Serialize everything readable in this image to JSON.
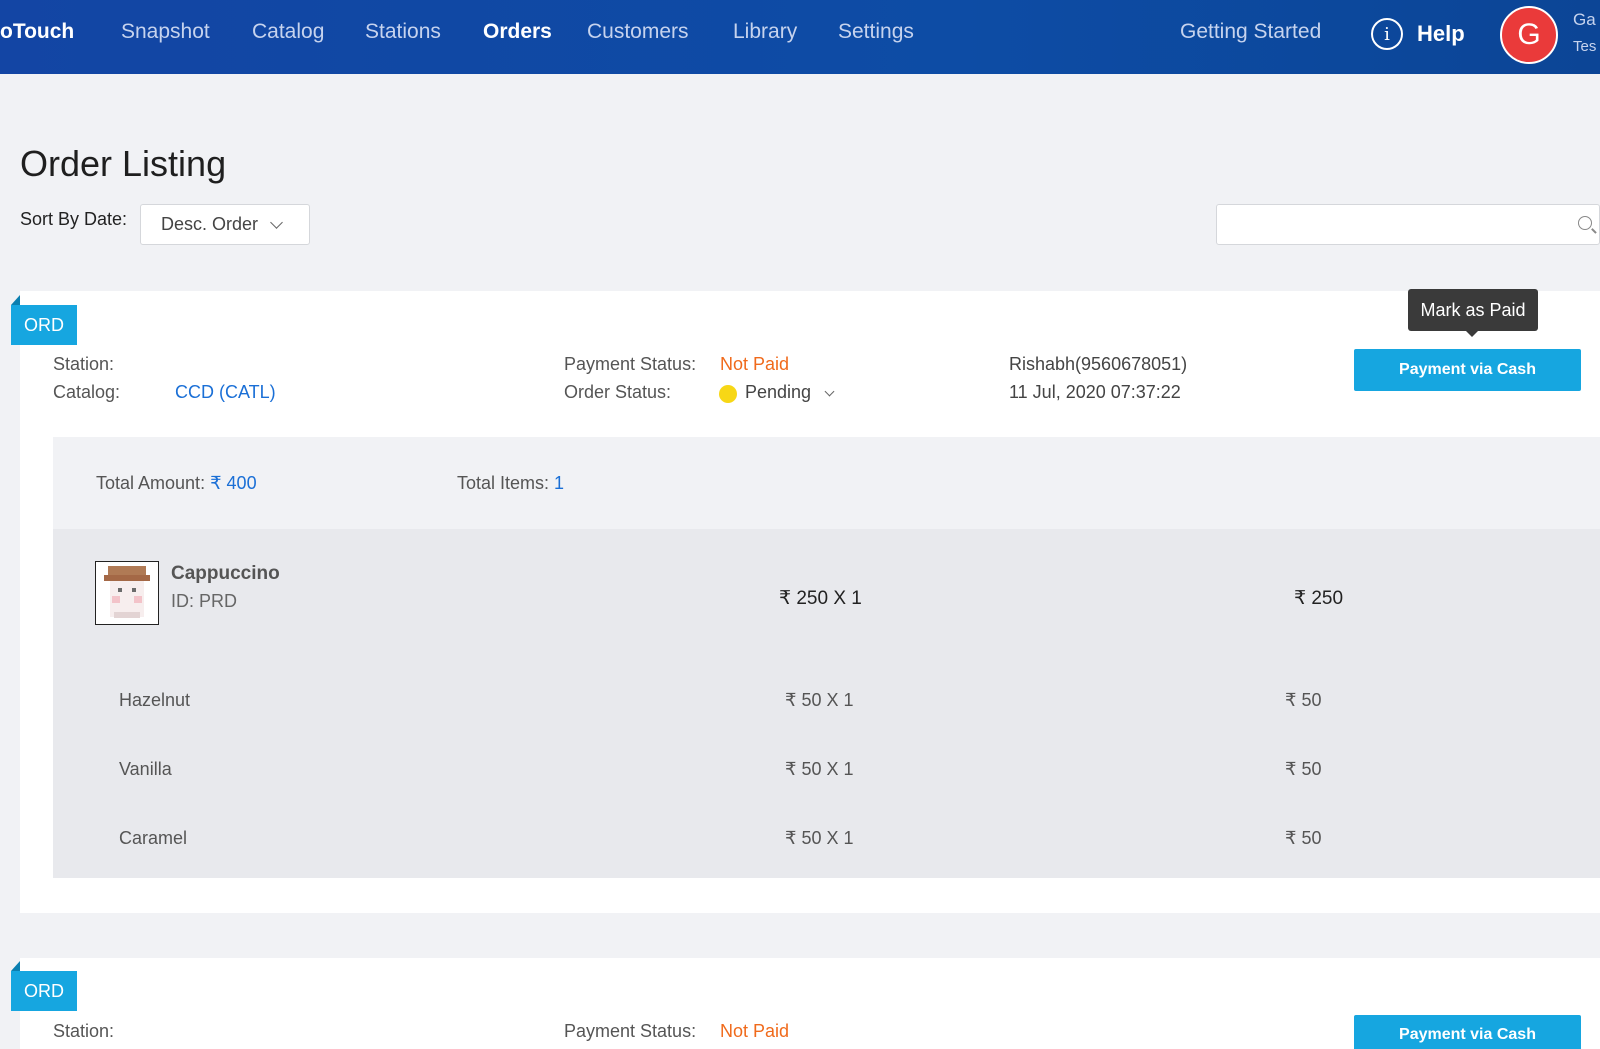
{
  "header": {
    "brand": "oTouch",
    "nav": [
      "Snapshot",
      "Catalog",
      "Stations",
      "Orders",
      "Customers",
      "Library",
      "Settings"
    ],
    "active_nav": "Orders",
    "getting_started": "Getting Started",
    "help": "Help",
    "avatar_initial": "G",
    "user_name": "Ga",
    "user_sub": "Tes"
  },
  "page": {
    "title": "Order Listing",
    "sort_label": "Sort By Date:",
    "sort_value": "Desc. Order",
    "search_value": ""
  },
  "tooltip": "Mark as Paid",
  "orders": [
    {
      "tag": "ORD",
      "station_label": "Station:",
      "station_value": "",
      "catalog_label": "Catalog:",
      "catalog_value": "CCD (CATL)",
      "payment_status_label": "Payment Status:",
      "payment_status": "Not Paid",
      "order_status_label": "Order Status:",
      "order_status": "Pending",
      "customer": "Rishabh(9560678051)",
      "datetime": "11 Jul, 2020 07:37:22",
      "action": "Payment via Cash",
      "total_amount_label": "Total Amount:",
      "total_amount": "₹ 400",
      "total_items_label": "Total Items:",
      "total_items": "1",
      "product": {
        "name": "Cappuccino",
        "id": "ID: PRD",
        "price_qty": "₹ 250 X 1",
        "total": "₹ 250"
      },
      "addons": [
        {
          "name": "Hazelnut",
          "price_qty": "₹ 50 X 1",
          "total": "₹ 50"
        },
        {
          "name": "Vanilla",
          "price_qty": "₹ 50 X 1",
          "total": "₹ 50"
        },
        {
          "name": "Caramel",
          "price_qty": "₹ 50 X 1",
          "total": "₹ 50"
        }
      ]
    },
    {
      "tag": "ORD",
      "station_label": "Station:",
      "payment_status_label": "Payment Status:",
      "payment_status": "Not Paid",
      "action": "Payment via Cash"
    }
  ],
  "colors": {
    "header_bg": "#1345a4",
    "accent": "#16a6e0",
    "link": "#1a6fd6",
    "not_paid": "#f06a1b",
    "pending_dot": "#f7d716",
    "avatar_bg": "#ea3a3a"
  }
}
